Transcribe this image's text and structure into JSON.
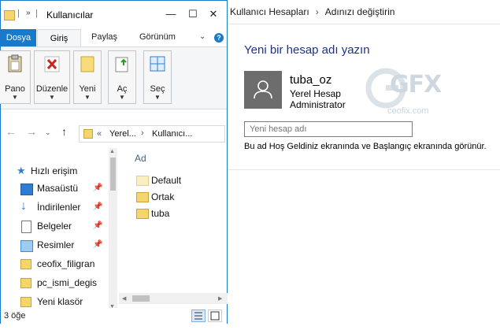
{
  "control_panel": {
    "breadcrumb": [
      "Kullanıcı Hesapları",
      "Adınızı değiştirin"
    ],
    "title": "Yeni bir hesap adı yazın",
    "user": {
      "name": "tuba_oz",
      "type": "Yerel Hesap",
      "role": "Administrator"
    },
    "name_input": {
      "placeholder": "Yeni hesap adı",
      "value": ""
    },
    "help_text": "Bu ad Hoş Geldiniz ekranında ve Başlangıç ekranında görünür.",
    "watermark": {
      "logo": "GFX",
      "url": "ceofix.com"
    }
  },
  "explorer": {
    "window_title": "Kullanıcılar",
    "window_controls": {
      "minimize": "—",
      "maximize": "☐",
      "close": "✕"
    },
    "ribbon_tabs": [
      "Dosya",
      "Giriş",
      "Paylaş",
      "Görünüm"
    ],
    "ribbon_groups": [
      {
        "label": "Pano",
        "icon": "clipboard-icon"
      },
      {
        "label": "Düzenle",
        "icon": "delete-icon"
      },
      {
        "label": "Yeni",
        "icon": "new-folder-icon"
      },
      {
        "label": "Aç",
        "icon": "open-icon"
      },
      {
        "label": "Seç",
        "icon": "select-icon"
      }
    ],
    "address": {
      "overflow": "«",
      "parts": [
        "Yerel...",
        "Kullanıcı..."
      ]
    },
    "nav_items": [
      {
        "label": "Hızlı erişim",
        "icon": "star-icon",
        "pinned": false
      },
      {
        "label": "Masaüstü",
        "icon": "desktop-icon",
        "pinned": true
      },
      {
        "label": "İndirilenler",
        "icon": "download-icon",
        "pinned": true
      },
      {
        "label": "Belgeler",
        "icon": "documents-icon",
        "pinned": true
      },
      {
        "label": "Resimler",
        "icon": "pictures-icon",
        "pinned": true
      },
      {
        "label": "ceofix_filigran",
        "icon": "folder-icon",
        "pinned": false
      },
      {
        "label": "pc_ismi_degis",
        "icon": "folder-icon",
        "pinned": false
      },
      {
        "label": "Yeni klasör",
        "icon": "folder-icon",
        "pinned": false
      }
    ],
    "column_header": "Ad",
    "files": [
      {
        "name": "Default",
        "icon": "folder-faded-icon"
      },
      {
        "name": "Ortak",
        "icon": "folder-icon"
      },
      {
        "name": "tuba",
        "icon": "folder-icon"
      }
    ],
    "status": "3 öğe",
    "colors": {
      "accent": "#1979ca",
      "folder": "#f4d66e"
    }
  }
}
